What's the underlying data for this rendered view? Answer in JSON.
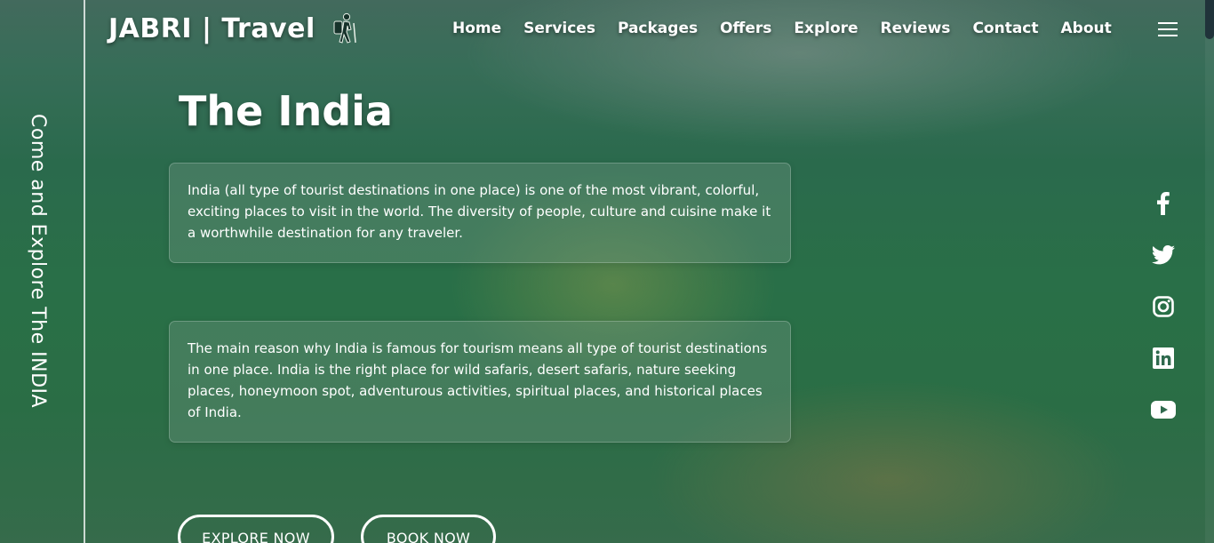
{
  "brand": {
    "name": "JABRI | Travel",
    "icon": "hiker-icon"
  },
  "nav": {
    "items": [
      "Home",
      "Services",
      "Packages",
      "Offers",
      "Explore",
      "Reviews",
      "Contact",
      "About"
    ]
  },
  "menu": {
    "icon": "hamburger-menu-icon"
  },
  "side": {
    "tagline": "Come and Explore The INDIA"
  },
  "hero": {
    "title": "The India",
    "paragraph1": "India (all type of tourist destinations in one place) is one of the most vibrant, colorful, exciting places to visit in the world. The diversity of people, culture and cuisine make it a worthwhile destination for any traveler.",
    "paragraph2": "The main reason why India is famous for tourism means all type of tourist destinations in one place. India is the right place for wild safaris, desert safaris, nature seeking places, honeymoon spot, adventurous activities, spiritual places, and historical places of India."
  },
  "buttons": {
    "explore": "EXPLORE NOW",
    "book": "BOOK NOW"
  },
  "social": [
    "facebook-icon",
    "twitter-icon",
    "instagram-icon",
    "linkedin-icon",
    "youtube-icon"
  ],
  "colors": {
    "overlay": "#1f6e48",
    "text": "#ffffff",
    "card": "#6e9682"
  }
}
